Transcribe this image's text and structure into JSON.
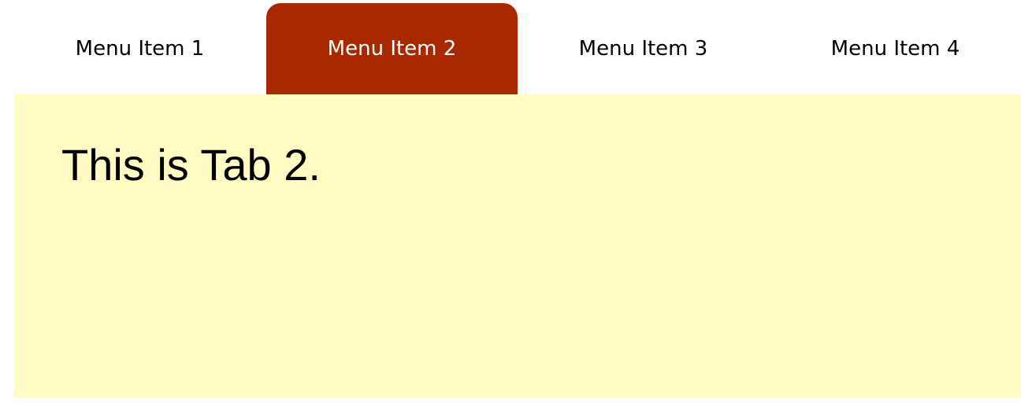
{
  "tabs": [
    {
      "label": "Menu Item 1",
      "active": false
    },
    {
      "label": "Menu Item 2",
      "active": true
    },
    {
      "label": "Menu Item 3",
      "active": false
    },
    {
      "label": "Menu Item 4",
      "active": false
    }
  ],
  "panel": {
    "text": "This is Tab 2."
  },
  "colors": {
    "active_tab": "#a82900",
    "panel_background": "#fffbc3",
    "page_background": "#ffffff"
  }
}
